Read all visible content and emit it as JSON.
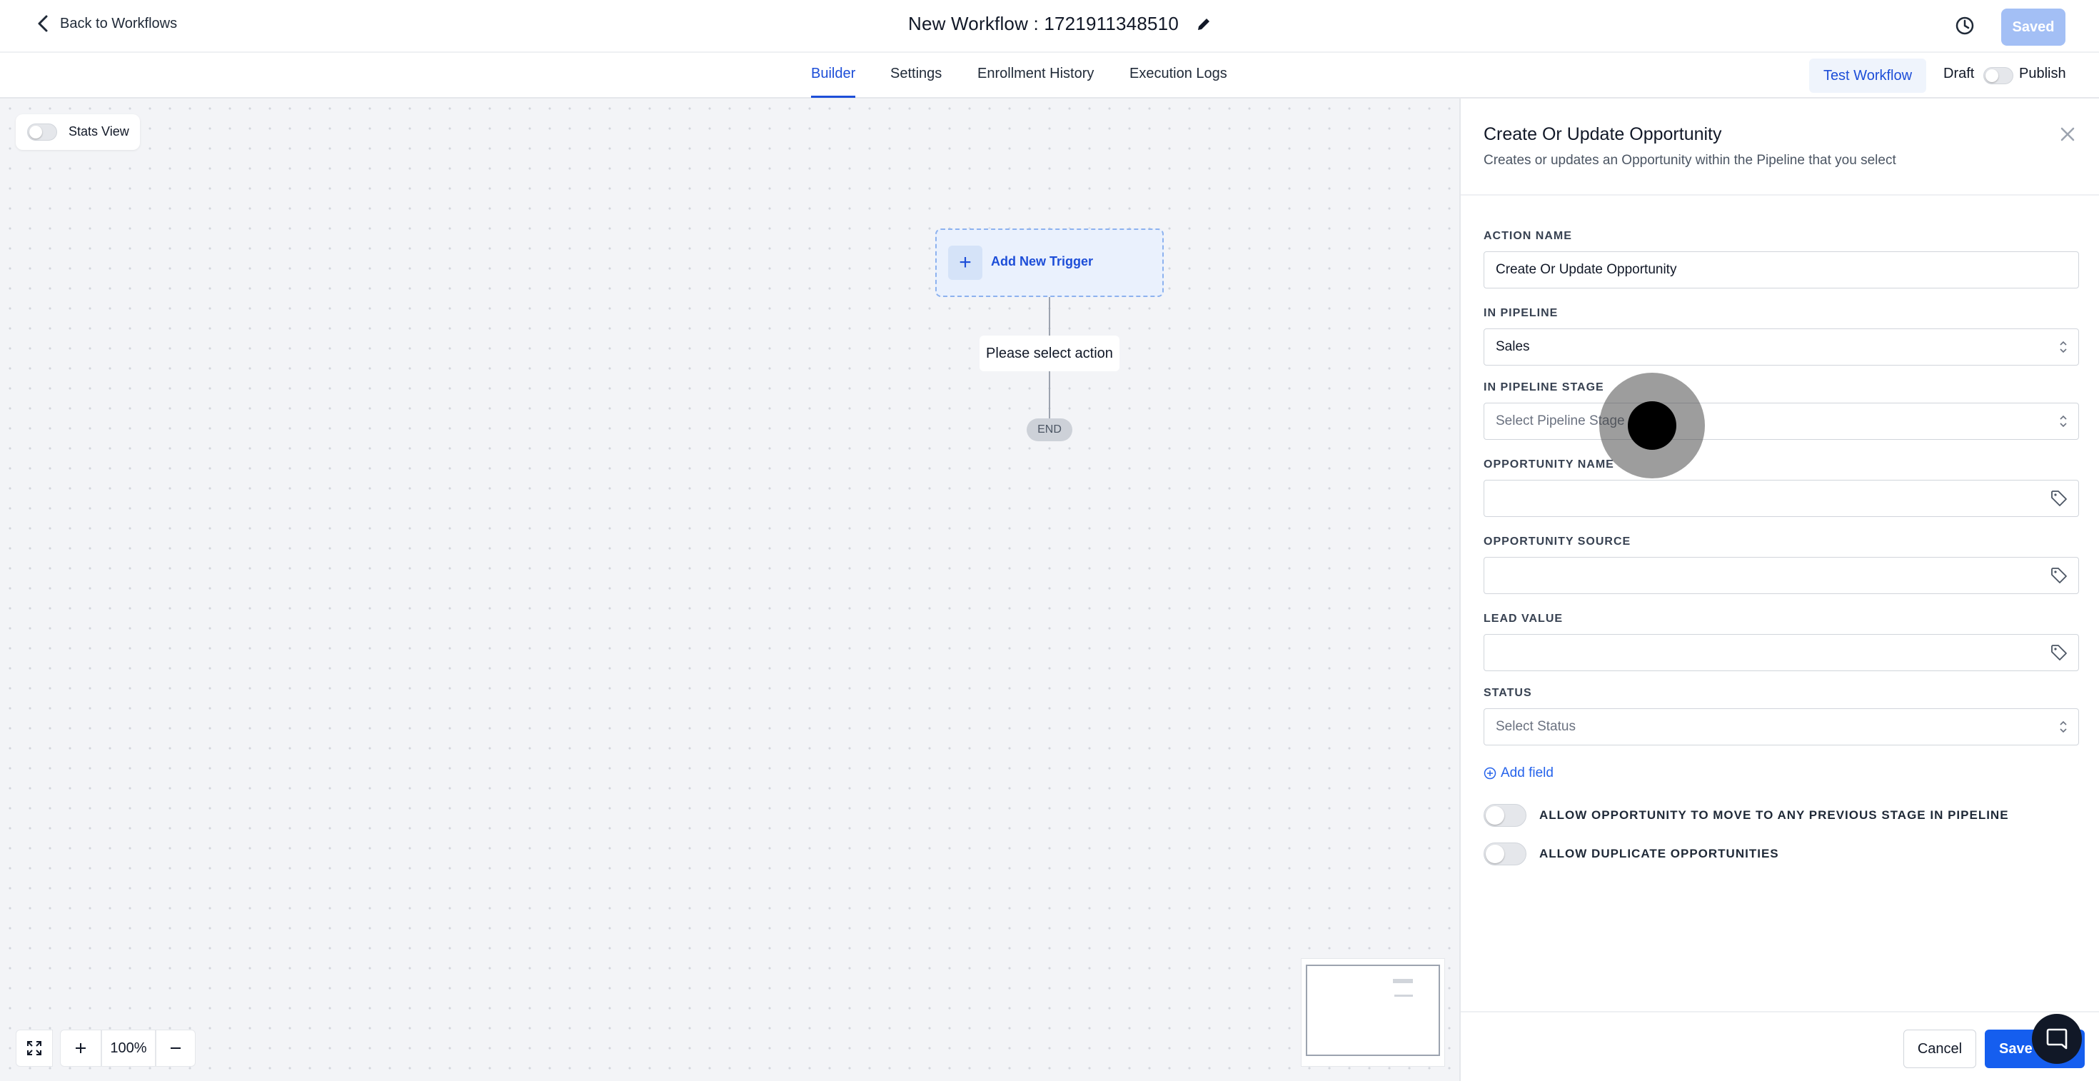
{
  "header": {
    "back_label": "Back to Workflows",
    "title": "New Workflow : 1721911348510",
    "saved_label": "Saved"
  },
  "tabs": [
    {
      "label": "Builder",
      "active": true
    },
    {
      "label": "Settings",
      "active": false
    },
    {
      "label": "Enrollment History",
      "active": false
    },
    {
      "label": "Execution Logs",
      "active": false
    }
  ],
  "toolbar": {
    "test_label": "Test Workflow",
    "draft_label": "Draft",
    "publish_label": "Publish"
  },
  "canvas": {
    "stats_label": "Stats View",
    "trigger_label": "Add New Trigger",
    "action_placeholder": "Please select action",
    "end_label": "END",
    "zoom_level": "100%"
  },
  "panel": {
    "title": "Create Or Update Opportunity",
    "subtitle": "Creates or updates an Opportunity within the Pipeline that you select",
    "fields": {
      "action_name": {
        "label": "ACTION NAME",
        "value": "Create Or Update Opportunity"
      },
      "pipeline": {
        "label": "IN PIPELINE",
        "value": "Sales"
      },
      "pipeline_stage": {
        "label": "IN PIPELINE STAGE",
        "placeholder": "Select Pipeline Stage"
      },
      "opportunity_name": {
        "label": "OPPORTUNITY NAME",
        "value": ""
      },
      "opportunity_source": {
        "label": "OPPORTUNITY SOURCE",
        "value": ""
      },
      "lead_value": {
        "label": "LEAD VALUE",
        "value": ""
      },
      "status": {
        "label": "STATUS",
        "placeholder": "Select Status"
      }
    },
    "add_field_label": "Add field",
    "toggles": {
      "allow_previous_stage": "ALLOW OPPORTUNITY TO MOVE TO ANY PREVIOUS STAGE IN PIPELINE",
      "allow_duplicates": "ALLOW DUPLICATE OPPORTUNITIES"
    },
    "cancel_label": "Cancel",
    "save_label": "Save A"
  },
  "colors": {
    "accent": "#1d4ed8",
    "primary_button": "#155eef",
    "saved_button": "#a3bff5"
  }
}
